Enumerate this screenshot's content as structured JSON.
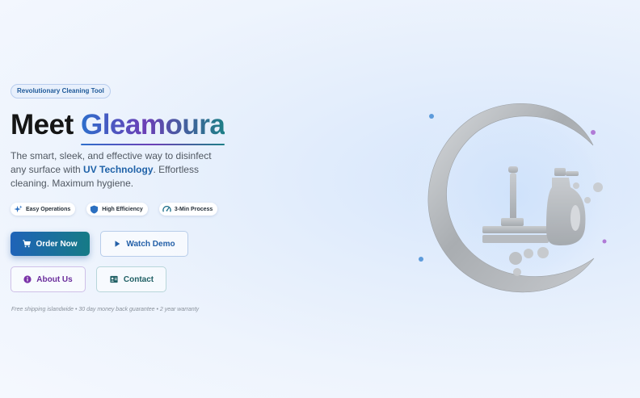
{
  "hero": {
    "badge": "Revolutionary Cleaning Tool",
    "title_prefix": "Meet ",
    "title_brand": "Gleamoura",
    "desc_part1": "The smart, sleek, and effective way to disinfect any surface with ",
    "desc_highlight": "UV Technology",
    "desc_part2": ". Effortless cleaning. Maximum hygiene."
  },
  "features": [
    {
      "label": "Easy Operations",
      "icon": "sparkle-icon"
    },
    {
      "label": "High Efficiency",
      "icon": "shield-icon"
    },
    {
      "label": "3-Min Process",
      "icon": "speedometer-icon"
    }
  ],
  "buttons": {
    "order": "Order Now",
    "demo": "Watch Demo",
    "about": "About Us",
    "contact": "Contact"
  },
  "footer_note": "Free shipping islandwide • 30 day money back guarantee • 2 year warranty",
  "colors": {
    "primary": "#1f63b8",
    "teal": "#167b86",
    "purple": "#6b3fb6",
    "dark_text": "#151515"
  }
}
